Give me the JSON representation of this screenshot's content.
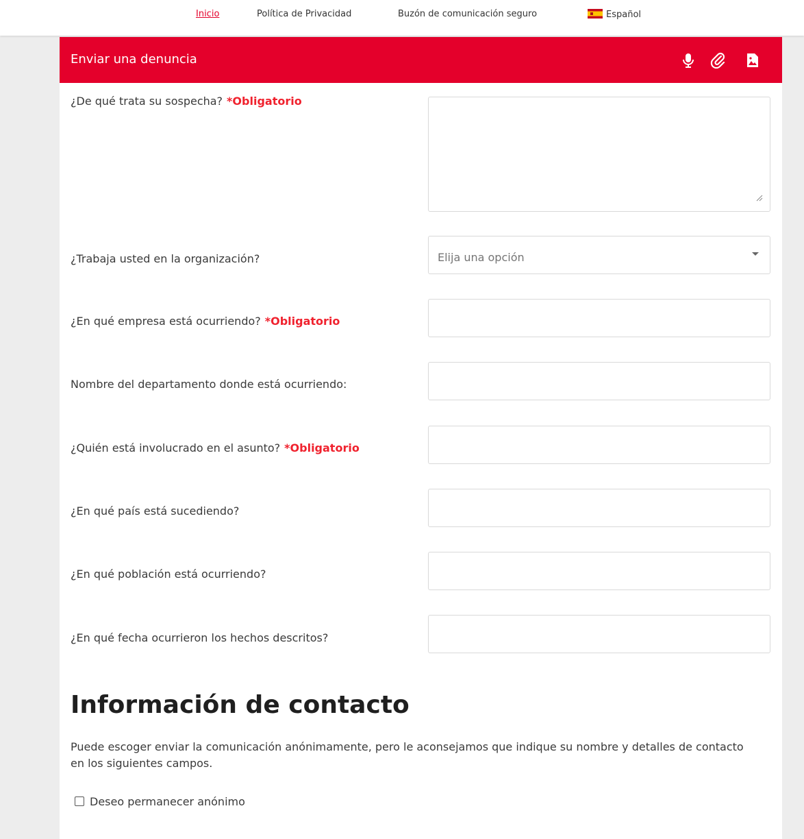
{
  "topnav": {
    "home": "Inicio",
    "privacy": "Política de Privacidad",
    "mailbox": "Buzón de comunicación seguro",
    "language": "Español"
  },
  "form": {
    "title": "Enviar una denuncia",
    "required_label": "*Obligatorio",
    "fields": {
      "suspicion": "¿De qué trata su sospecha?",
      "works_in_org": "¿Trabaja usted en la organización?",
      "works_in_org_placeholder": "Elija una opción",
      "company": "¿En qué empresa está ocurriendo?",
      "department": "Nombre del departamento donde está ocurriendo:",
      "involved": "¿Quién está involucrado en el asunto?",
      "country": "¿En qué país está sucediendo?",
      "town": "¿En qué población está ocurriendo?",
      "date": "¿En qué fecha ocurrieron los hechos descritos?"
    }
  },
  "contact": {
    "heading": "Información de contacto",
    "description": "Puede escoger enviar la comunicación anónimamente, pero le aconsejamos que indique su nombre y detalles de contacto en los siguientes campos.",
    "anonymous_label": "Deseo permanecer anónimo"
  },
  "colors": {
    "accent": "#e4002b",
    "required": "#f0222e"
  },
  "icons": [
    "microphone-icon",
    "paperclip-icon",
    "file-image-icon",
    "spain-flag-icon",
    "chevron-down-icon"
  ]
}
